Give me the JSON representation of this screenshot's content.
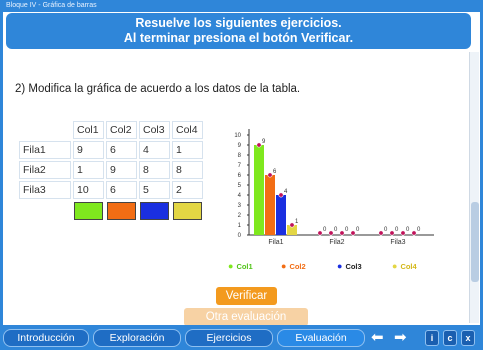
{
  "window": {
    "title": "Bloque IV - Gráfica de barras"
  },
  "banner": {
    "line1": "Resuelve los siguientes ejercicios.",
    "line2": "Al terminar presiona el botón Verificar."
  },
  "question": "2) Modifica la gráfica de acuerdo a los datos de la tabla.",
  "table": {
    "headers": [
      "Col1",
      "Col2",
      "Col3",
      "Col4"
    ],
    "rows": [
      {
        "label": "Fila1",
        "values": [
          "9",
          "6",
          "4",
          "1"
        ]
      },
      {
        "label": "Fila2",
        "values": [
          "1",
          "9",
          "8",
          "8"
        ]
      },
      {
        "label": "Fila3",
        "values": [
          "10",
          "6",
          "5",
          "2"
        ]
      }
    ],
    "swatch_colors": [
      "#7fe81e",
      "#f26d14",
      "#1a2fe0",
      "#e3d644"
    ]
  },
  "chart_data": {
    "type": "bar",
    "categories": [
      "Fila1",
      "Fila2",
      "Fila3"
    ],
    "series": [
      {
        "name": "Col1",
        "values": [
          9,
          0,
          0
        ],
        "color": "#7fe81e",
        "label_color": "#52c41a"
      },
      {
        "name": "Col2",
        "values": [
          6,
          0,
          0
        ],
        "color": "#f26d14",
        "label_color": "#f26d14"
      },
      {
        "name": "Col3",
        "values": [
          4,
          0,
          0
        ],
        "color": "#1a2fe0",
        "label_color": "#222222"
      },
      {
        "name": "Col4",
        "values": [
          1,
          0,
          0
        ],
        "color": "#e3d644",
        "label_color": "#d4b81a"
      }
    ],
    "ylim": [
      0,
      10
    ],
    "yticks": [
      "0",
      "1",
      "2",
      "3",
      "4",
      "5",
      "6",
      "7",
      "8",
      "9",
      "10"
    ],
    "handle_color": "#c0125a",
    "legend_position": "bottom"
  },
  "buttons": {
    "verify": "Verificar",
    "other": "Otra evaluación"
  },
  "nav": {
    "items": [
      "Introducción",
      "Exploración",
      "Ejercicios",
      "Evaluación"
    ],
    "active": "Evaluación",
    "icons": {
      "prev": "left-arrow-icon",
      "next": "right-arrow-icon"
    },
    "small_buttons": [
      "i",
      "c",
      "x"
    ]
  }
}
